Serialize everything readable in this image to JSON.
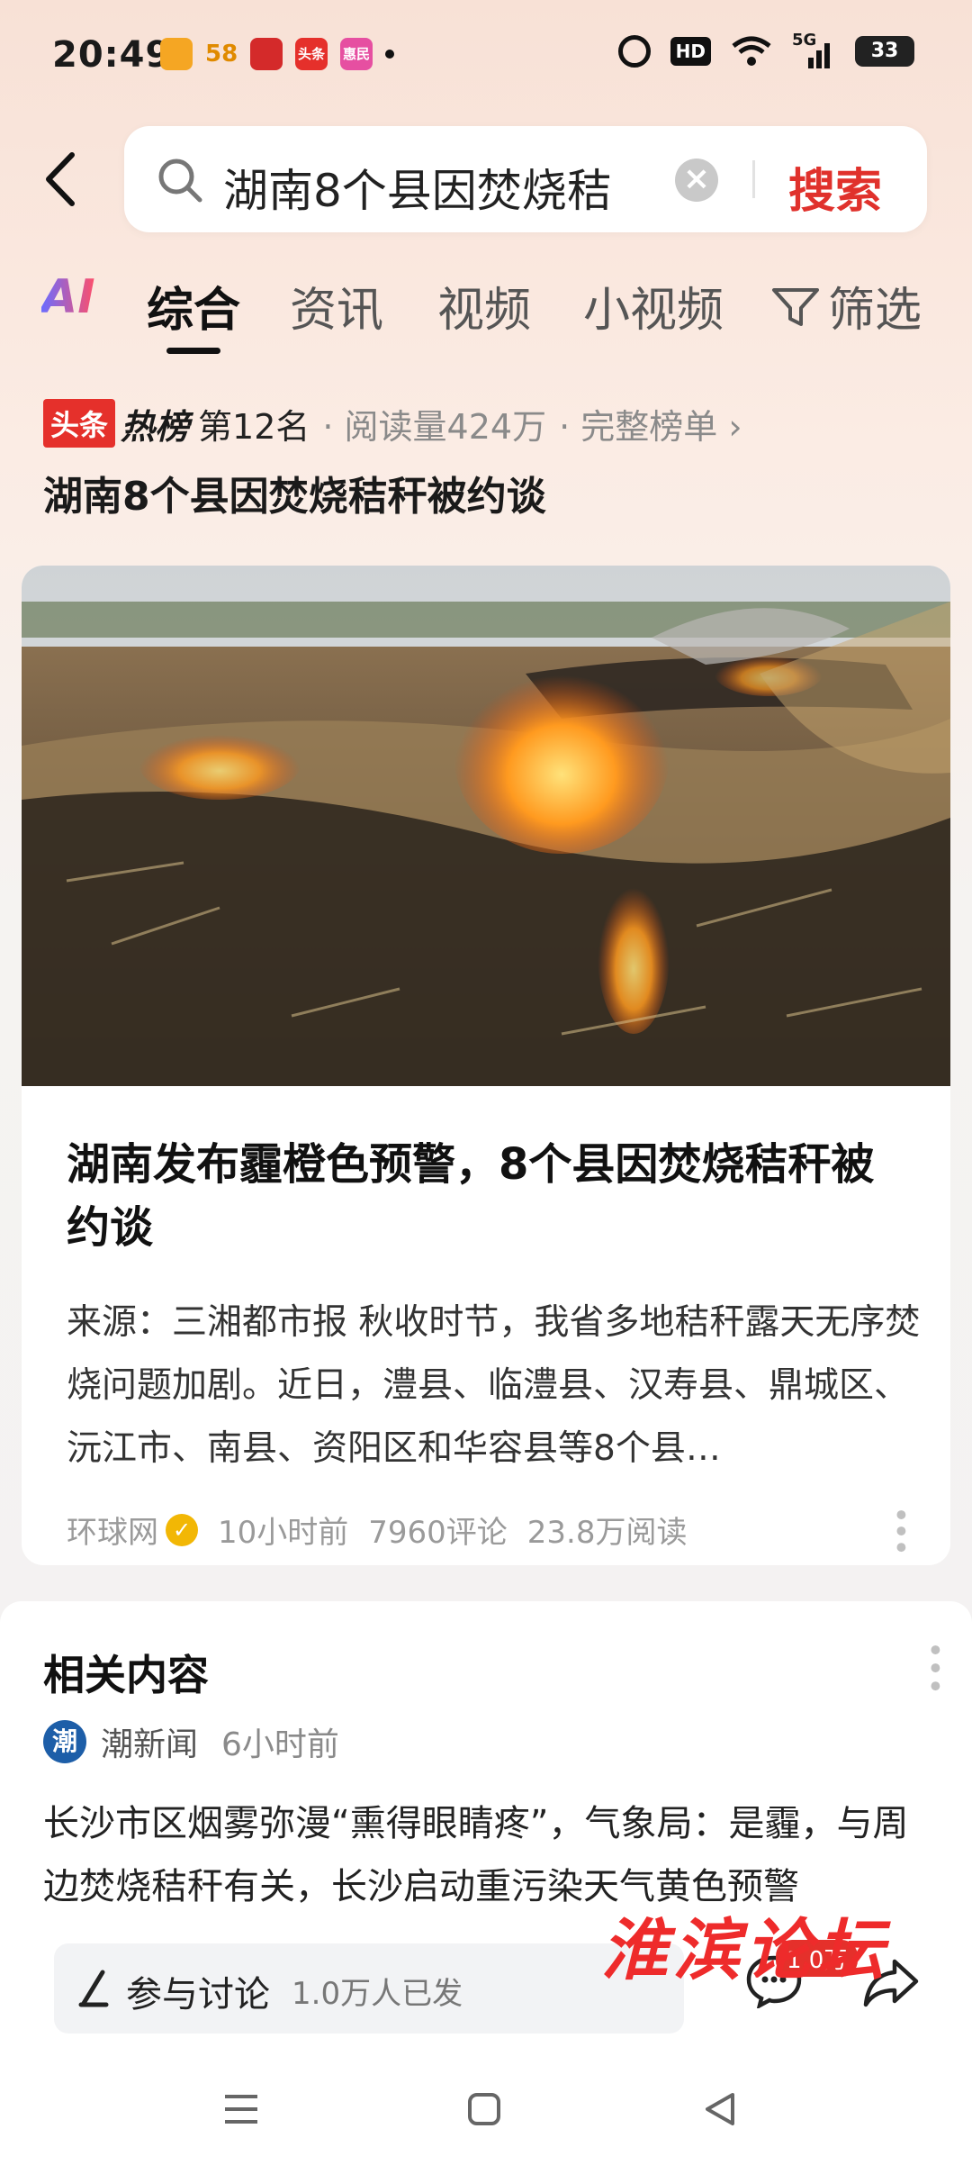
{
  "status_bar": {
    "time": "20:49",
    "notifications": [
      "app-1",
      "58",
      "app-3",
      "头条",
      "惠民"
    ],
    "network": "5G",
    "battery": "33"
  },
  "search": {
    "query": "湖南8个县因焚烧秸",
    "button": "搜索"
  },
  "tabs": [
    "综合",
    "资讯",
    "视频",
    "小视频"
  ],
  "tabs_filter": "筛选",
  "hotlist": {
    "badge_left": "头条",
    "badge_right": "热榜",
    "rank": "第12名",
    "reads": "· 阅读量424万",
    "full": "· 完整榜单 ›",
    "headline": "湖南8个县因焚烧秸秆被约谈"
  },
  "article": {
    "title": "湖南发布霾橙色预警，8个县因焚烧秸秆被约谈",
    "desc": "来源：三湘都市报 秋收时节，我省多地秸秆露天无序焚烧问题加剧。近日，澧县、临澧县、汉寿县、鼎城区、沅江市、南县、资阳区和华容县等8个县…",
    "source": "环球网",
    "time": "10小时前",
    "comments": "7960评论",
    "reads": "23.8万阅读"
  },
  "related": {
    "heading": "相关内容",
    "source": "潮新闻",
    "source_icon_text": "潮",
    "time": "6小时前",
    "text": "长沙市区烟雾弥漫“熏得眼睛疼”，气象局：是霾，与周边焚烧秸秆有关，长沙启动重污染天气黄色预警"
  },
  "bottom": {
    "discuss_label": "参与讨论",
    "discuss_count": "1.0万人已发",
    "comment_badge": "1.0万"
  },
  "watermark": "淮滨论坛",
  "colors": {
    "accent_red": "#e0312c",
    "badge_red": "#e5302b"
  }
}
